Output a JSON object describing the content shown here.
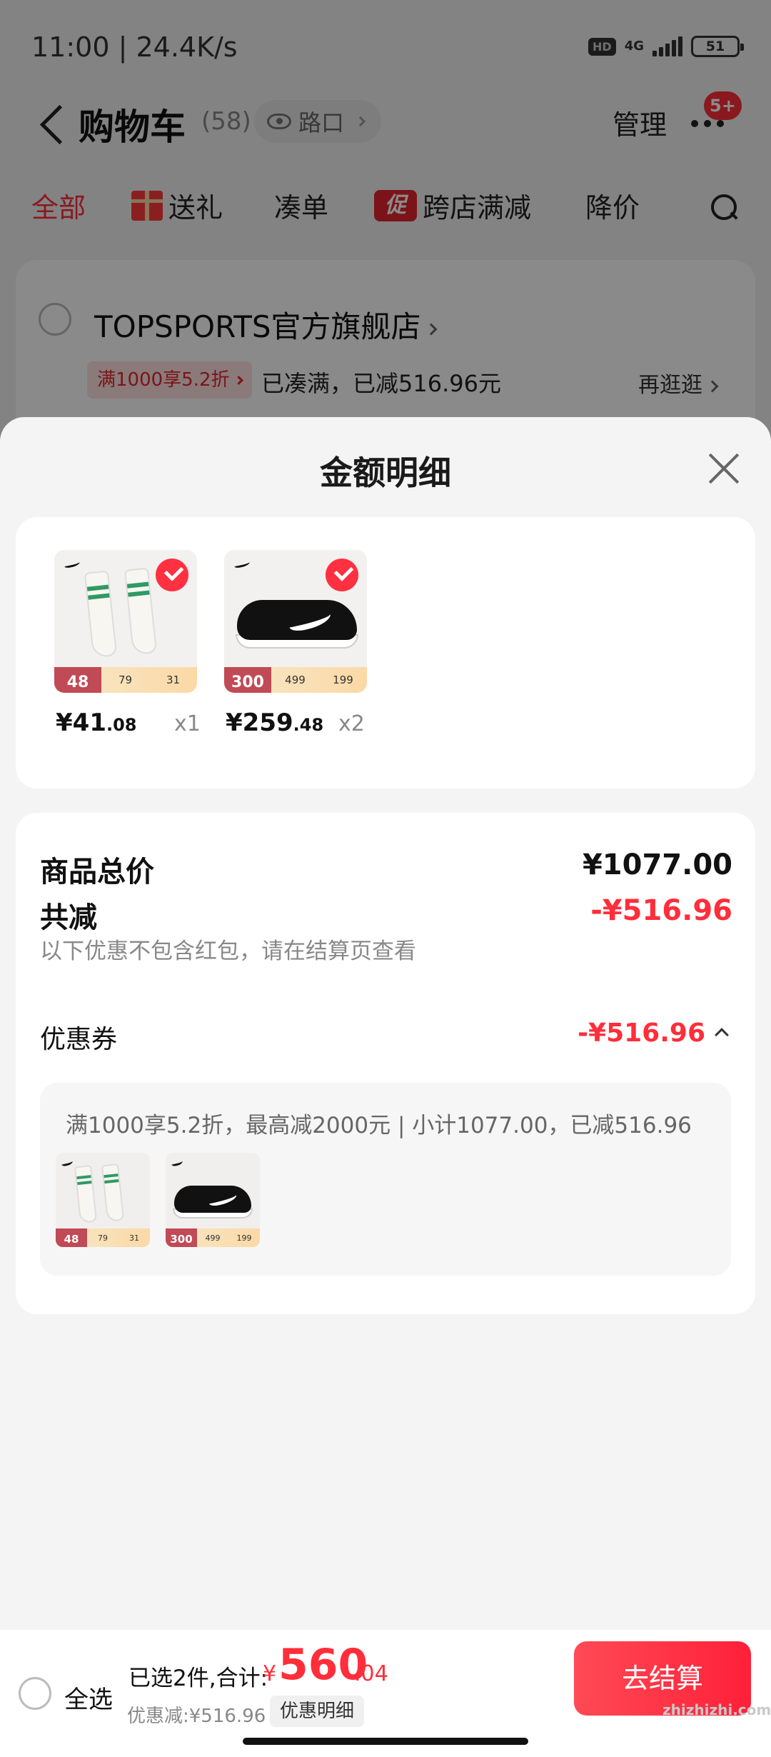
{
  "status_bar": {
    "time_speed": "11:00 | 24.4K/s",
    "hd": "HD",
    "network": "4G",
    "battery": "51"
  },
  "header": {
    "title": "购物车",
    "count": "(58)",
    "location": "路口",
    "manage": "管理",
    "badge": "5+"
  },
  "tabs": [
    {
      "label": "全部",
      "active": true
    },
    {
      "label": "送礼"
    },
    {
      "label": "凑单"
    },
    {
      "label": "跨店满减",
      "icon_text": "促"
    },
    {
      "label": "降价"
    }
  ],
  "store": {
    "name": "TOPSPORTS官方旗舰店",
    "promo_tag": "满1000享5.2折",
    "promo_text": "已凑满，已减516.96元",
    "more": "再逛逛"
  },
  "sheet": {
    "title": "金额明细",
    "items": [
      {
        "price_int": "¥41",
        "price_dec": ".08",
        "qty": "x1",
        "tag": "48",
        "strip_a": "79",
        "strip_b": "31"
      },
      {
        "price_int": "¥259",
        "price_dec": ".48",
        "qty": "x2",
        "tag": "300",
        "strip_a": "499",
        "strip_b": "199"
      }
    ],
    "total_label": "商品总价",
    "total_value": "¥1077.00",
    "reduce_label": "共减",
    "reduce_value": "-¥516.96",
    "note": "以下优惠不包含红包，请在结算页查看",
    "coupon_label": "优惠券",
    "coupon_value": "-¥516.96",
    "coupon_desc": "满1000享5.2折，最高减2000元 | 小计1077.00，已减516.96"
  },
  "bottom": {
    "select_all": "全选",
    "selected_info": "已选2件,合计:",
    "currency": "¥",
    "total_int": "560",
    "total_dec": ".04",
    "discount": "优惠减:¥516.96",
    "detail_button": "优惠明细",
    "checkout": "去结算",
    "watermark": "zhizhizhi.com"
  },
  "colors": {
    "accent_red": "#ff2e3a",
    "overlay": "rgba(0,0,0,0.46)"
  }
}
